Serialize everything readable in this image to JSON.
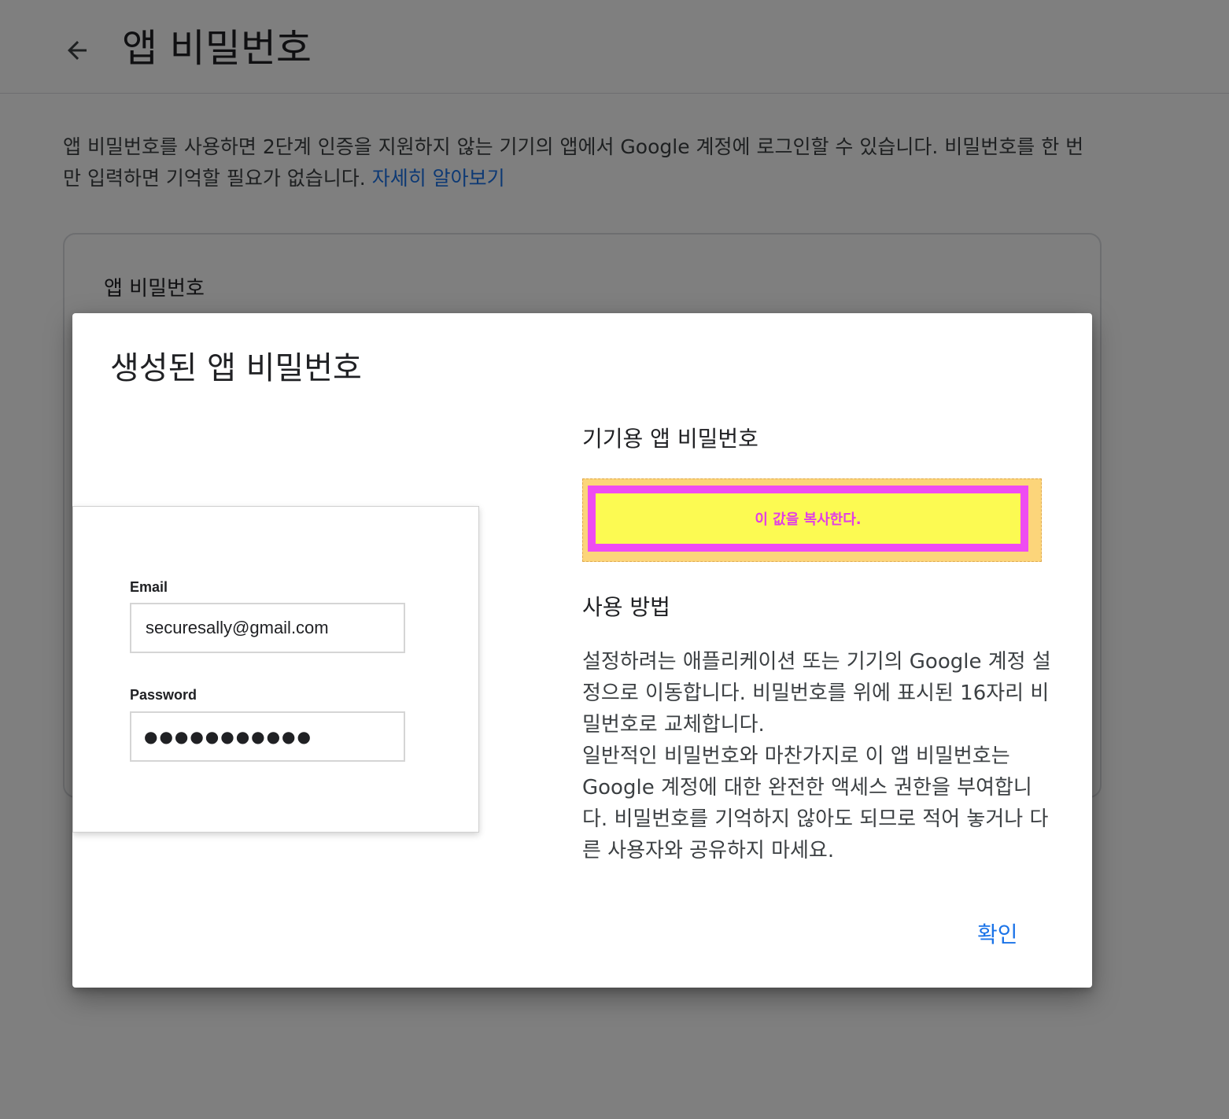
{
  "header": {
    "back_icon": "arrow-left-icon",
    "title": "앱 비밀번호"
  },
  "intro": {
    "text": "앱 비밀번호를 사용하면 2단계 인증을 지원하지 않는 기기의 앱에서 Google 계정에 로그인할 수 있습니다. 비밀번호를 한 번만 입력하면 기억할 필요가 없습니다. ",
    "link_text": "자세히 알아보기"
  },
  "card": {
    "title": "앱 비밀번호"
  },
  "dialog": {
    "title": "생성된 앱 비밀번호",
    "illustration": {
      "email_label": "Email",
      "email_value": "securesally@gmail.com",
      "password_label": "Password",
      "password_mask": "●●●●●●●●●●●"
    },
    "device_heading": "기기용 앱 비밀번호",
    "password_placeholder": "이 값을 복사한다.",
    "usage_heading": "사용 방법",
    "usage_paragraph_1": "설정하려는 애플리케이션 또는 기기의 Google 계정 설정으로 이동합니다. 비밀번호를 위에 표시된 16자리 비밀번호로 교체합니다.",
    "usage_paragraph_2": "일반적인 비밀번호와 마찬가지로 이 앱 비밀번호는 Google 계정에 대한 완전한 액세스 권한을 부여합니다. 비밀번호를 기억하지 않아도 되므로 적어 놓거나 다른 사용자와 공유하지 마세요.",
    "confirm_label": "확인"
  },
  "colors": {
    "accent": "#1a73e8",
    "highlight_fill": "#fcfa52",
    "highlight_border": "#ef4cf2",
    "highlight_outer": "#fcd57a",
    "scrim": "rgba(0,0,0,0.5)"
  }
}
